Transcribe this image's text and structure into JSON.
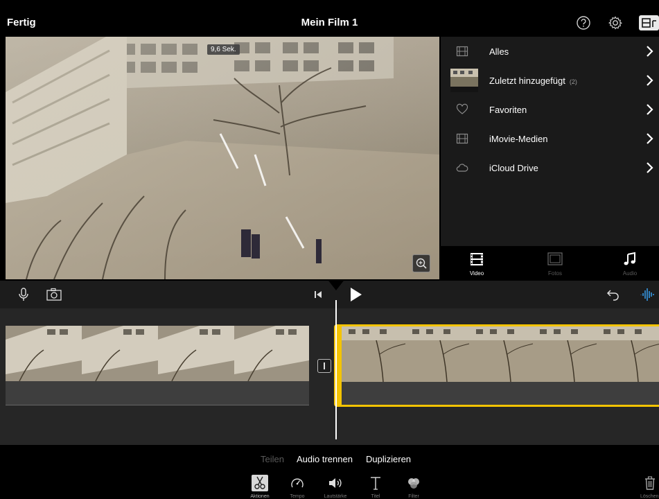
{
  "header": {
    "done_label": "Fertig",
    "title": "Mein Film 1",
    "help_icon": "help-icon",
    "settings_icon": "gear-icon",
    "layout_icon": "layout-toggle-icon"
  },
  "preview": {
    "duration_badge": "9,6 Sek.",
    "zoom_icon": "zoom-in-icon"
  },
  "library": {
    "items": [
      {
        "label": "Alles",
        "count": "",
        "icon": "film-icon"
      },
      {
        "label": "Zuletzt hinzugefügt",
        "count": "(2)",
        "icon": "thumbnail"
      },
      {
        "label": "Favoriten",
        "count": "",
        "icon": "heart-icon"
      },
      {
        "label": "iMovie-Medien",
        "count": "",
        "icon": "film-icon"
      },
      {
        "label": "iCloud Drive",
        "count": "",
        "icon": "cloud-icon"
      }
    ],
    "tabs": [
      {
        "label": "Video",
        "icon": "video-icon",
        "active": true
      },
      {
        "label": "Fotos",
        "icon": "photos-icon",
        "active": false
      },
      {
        "label": "Audio",
        "icon": "music-note-icon",
        "active": false
      }
    ]
  },
  "timeline_toolbar": {
    "mic_icon": "microphone-icon",
    "camera_icon": "camera-icon",
    "skip_back_icon": "skip-to-start-icon",
    "play_icon": "play-icon",
    "undo_icon": "undo-icon",
    "waveform_icon": "audio-waveform-icon"
  },
  "actions": {
    "split": "Teilen",
    "detach_audio": "Audio trennen",
    "duplicate": "Duplizieren"
  },
  "tools": [
    {
      "label": "Aktionen",
      "icon": "scissors-icon",
      "active": true
    },
    {
      "label": "Tempo",
      "icon": "speedometer-icon",
      "active": false
    },
    {
      "label": "Lautstärke",
      "icon": "speaker-icon",
      "active": false
    },
    {
      "label": "Titel",
      "icon": "title-t-icon",
      "active": false
    },
    {
      "label": "Filter",
      "icon": "filter-icon",
      "active": false
    }
  ],
  "delete": {
    "label": "Löschen",
    "icon": "trash-icon"
  },
  "colors": {
    "accent": "#f4c400",
    "waveform": "#3aa8ff"
  }
}
